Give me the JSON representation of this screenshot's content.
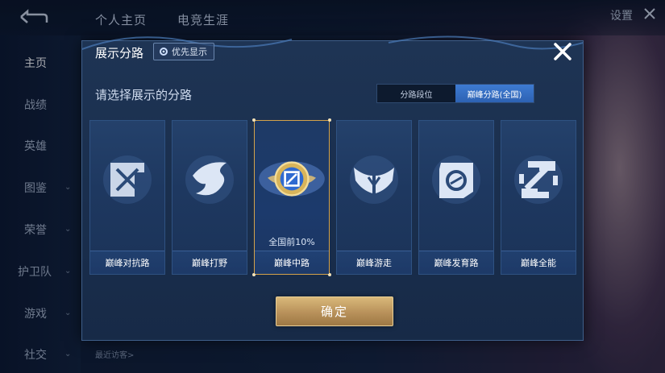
{
  "topbar": {
    "tabs": [
      "个人主页",
      "电竞生涯"
    ],
    "settings_label": "设置"
  },
  "sidebar": {
    "items": [
      {
        "label": "主页",
        "active": true
      },
      {
        "label": "战绩"
      },
      {
        "label": "英雄"
      },
      {
        "label": "图鉴"
      },
      {
        "label": "荣誉"
      },
      {
        "label": "护卫队"
      },
      {
        "label": "游戏"
      },
      {
        "label": "社交"
      }
    ]
  },
  "footer": {
    "recent_visitors": "最近访客>"
  },
  "dialog": {
    "title": "展示分路",
    "priority_label": "优先显示",
    "prompt": "请选择展示的分路",
    "tabs": [
      {
        "label": "分路段位",
        "active": false
      },
      {
        "label": "巅峰分路(全国)",
        "active": true
      }
    ],
    "cards": [
      {
        "label": "巅峰对抗路",
        "icon": "crossed-swords-icon"
      },
      {
        "label": "巅峰打野",
        "icon": "dragon-icon"
      },
      {
        "label": "巅峰中路",
        "icon": "mid-lane-gold-badge-icon",
        "selected": true,
        "rank_text": "全国前10%"
      },
      {
        "label": "巅峰游走",
        "icon": "wings-icon"
      },
      {
        "label": "巅峰发育路",
        "icon": "target-icon"
      },
      {
        "label": "巅峰全能",
        "icon": "all-round-icon"
      }
    ],
    "confirm_label": "确定"
  },
  "colors": {
    "accent_blue": "#2d62b3",
    "gold": "#d4a24a",
    "panel": "#1a2f4e"
  }
}
